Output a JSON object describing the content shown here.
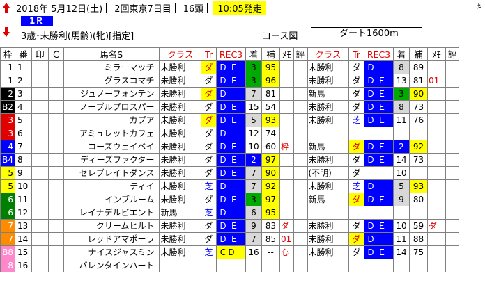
{
  "header": {
    "date": "2018年 5月12日(土)",
    "meeting": "2回東京7日目",
    "runners": "16頭",
    "start_time": "10:05発走",
    "race_no": "1Ｒ",
    "condition": "3歳･未勝利(馬齢)(牝)[指定]",
    "course_label": "コース図",
    "course": "ダート1600m",
    "corner": "ｷ"
  },
  "columns": {
    "waku": "枠",
    "ban": "番",
    "mark": "印",
    "c": "Ｃ",
    "name": "馬名S",
    "cls": "クラス",
    "tr": "Tr",
    "rec": "REC3",
    "chaku": "着",
    "ho": "補",
    "memo": "ﾒﾓ",
    "hyo": "評"
  },
  "rows": [
    {
      "waku": "1",
      "wc": "w1",
      "ban": "1",
      "name": "ミラーマッチ",
      "c1": "未勝利",
      "t1": "ダ",
      "t1c": "red",
      "t1bg": "bg-y",
      "r1": "Ｄ Ｅ",
      "r1bg": "bg-b",
      "k1": "3",
      "k1bg": "bg-g",
      "h1": "95",
      "h1bg": "bg-y",
      "m1": "",
      "m1c": "",
      "c2": "未勝利",
      "t2": "ダ",
      "t2c": "",
      "t2bg": "",
      "r2": "Ｄ",
      "r2bg": "bg-b",
      "k2": "8",
      "k2bg": "bg-lg",
      "h2": "89",
      "h2bg": "",
      "m2": "",
      "m2c": ""
    },
    {
      "waku": "1",
      "wc": "w1",
      "ban": "2",
      "name": "グラスコマチ",
      "c1": "未勝利",
      "t1": "ダ",
      "t1c": "",
      "t1bg": "",
      "r1": "Ｄ Ｅ",
      "r1bg": "bg-b",
      "k1": "3",
      "k1bg": "bg-g",
      "h1": "96",
      "h1bg": "bg-y",
      "m1": "",
      "m1c": "",
      "c2": "未勝利",
      "t2": "ダ",
      "t2c": "",
      "t2bg": "",
      "r2": "Ｄ Ｅ",
      "r2bg": "bg-b",
      "k2": "13",
      "k2bg": "",
      "h2": "81",
      "h2bg": "",
      "m2": "01",
      "m2c": "red"
    },
    {
      "waku": "2",
      "wc": "w2",
      "ban": "3",
      "name": "ジュノーフォンテン",
      "c1": "未勝利",
      "t1": "ダ",
      "t1c": "red",
      "t1bg": "bg-y",
      "r1": "Ｄ",
      "r1bg": "bg-b",
      "k1": "7",
      "k1bg": "bg-lg",
      "h1": "81",
      "h1bg": "",
      "m1": "",
      "m1c": "",
      "c2": "新馬",
      "t2": "ダ",
      "t2c": "",
      "t2bg": "",
      "r2": "Ｄ Ｅ",
      "r2bg": "bg-b",
      "k2": "3",
      "k2bg": "bg-g",
      "h2": "90",
      "h2bg": "bg-y",
      "m2": "",
      "m2c": ""
    },
    {
      "waku": "B2",
      "wc": "w2",
      "ban": "4",
      "name": "ノーブルプロスパー",
      "c1": "未勝利",
      "t1": "ダ",
      "t1c": "",
      "t1bg": "",
      "r1": "Ｄ Ｅ",
      "r1bg": "bg-b",
      "k1": "15",
      "k1bg": "",
      "h1": "54",
      "h1bg": "",
      "m1": "",
      "m1c": "",
      "c2": "未勝利",
      "t2": "ダ",
      "t2c": "",
      "t2bg": "",
      "r2": "Ｄ Ｅ",
      "r2bg": "bg-b",
      "k2": "8",
      "k2bg": "bg-lg",
      "h2": "73",
      "h2bg": "",
      "m2": "",
      "m2c": ""
    },
    {
      "waku": "3",
      "wc": "w3",
      "ban": "5",
      "name": "カプア",
      "c1": "未勝利",
      "t1": "ダ",
      "t1c": "red",
      "t1bg": "bg-y",
      "r1": "Ｄ Ｅ",
      "r1bg": "bg-b",
      "k1": "5",
      "k1bg": "bg-lg",
      "h1": "93",
      "h1bg": "bg-y",
      "m1": "",
      "m1c": "",
      "c2": "未勝利",
      "t2": "芝",
      "t2c": "blue",
      "t2bg": "",
      "r2": "Ｄ Ｅ",
      "r2bg": "bg-b",
      "k2": "11",
      "k2bg": "",
      "h2": "76",
      "h2bg": "",
      "m2": "",
      "m2c": ""
    },
    {
      "waku": "3",
      "wc": "w3",
      "ban": "6",
      "name": "アミュレットカフェ",
      "c1": "未勝利",
      "t1": "ダ",
      "t1c": "",
      "t1bg": "",
      "r1": "Ｄ",
      "r1bg": "bg-b",
      "k1": "12",
      "k1bg": "",
      "h1": "74",
      "h1bg": "",
      "m1": "",
      "m1c": "",
      "c2": "",
      "t2": "",
      "t2c": "",
      "t2bg": "",
      "r2": "",
      "r2bg": "",
      "k2": "",
      "k2bg": "",
      "h2": "",
      "h2bg": "",
      "m2": "",
      "m2c": ""
    },
    {
      "waku": "4",
      "wc": "w4",
      "ban": "7",
      "name": "コーズウェイベイ",
      "c1": "未勝利",
      "t1": "ダ",
      "t1c": "",
      "t1bg": "",
      "r1": "Ｄ Ｅ",
      "r1bg": "bg-b",
      "k1": "10",
      "k1bg": "",
      "h1": "60",
      "h1bg": "",
      "m1": "枠",
      "m1c": "red",
      "c2": "新馬",
      "t2": "ダ",
      "t2c": "red",
      "t2bg": "bg-y",
      "r2": "Ｄ Ｅ",
      "r2bg": "bg-b",
      "k2": "2",
      "k2bg": "bg-b",
      "h2": "92",
      "h2bg": "bg-y",
      "m2": "",
      "m2c": ""
    },
    {
      "waku": "B4",
      "wc": "w4",
      "ban": "8",
      "name": "ディーズファクター",
      "c1": "未勝利",
      "t1": "ダ",
      "t1c": "",
      "t1bg": "",
      "r1": "Ｄ Ｅ",
      "r1bg": "bg-b",
      "k1": "2",
      "k1bg": "bg-b",
      "h1": "97",
      "h1bg": "bg-y",
      "m1": "",
      "m1c": "",
      "c2": "未勝利",
      "t2": "ダ",
      "t2c": "",
      "t2bg": "",
      "r2": "Ｄ Ｅ",
      "r2bg": "bg-b",
      "k2": "14",
      "k2bg": "",
      "h2": "73",
      "h2bg": "",
      "m2": "",
      "m2c": ""
    },
    {
      "waku": "5",
      "wc": "w5",
      "ban": "9",
      "name": "セレブレイトダンス",
      "c1": "未勝利",
      "t1": "ダ",
      "t1c": "",
      "t1bg": "",
      "r1": "Ｄ Ｅ",
      "r1bg": "bg-b",
      "k1": "7",
      "k1bg": "bg-lg",
      "h1": "90",
      "h1bg": "bg-y",
      "m1": "",
      "m1c": "",
      "c2": "(不明)",
      "t2": "ダ",
      "t2c": "",
      "t2bg": "",
      "r2": "",
      "r2bg": "",
      "k2": "10",
      "k2bg": "",
      "h2": "",
      "h2bg": "",
      "m2": "",
      "m2c": ""
    },
    {
      "waku": "5",
      "wc": "w5",
      "ban": "10",
      "name": "ティイ",
      "c1": "未勝利",
      "t1": "芝",
      "t1c": "blue",
      "t1bg": "",
      "r1": "Ｄ",
      "r1bg": "bg-b",
      "k1": "7",
      "k1bg": "bg-lg",
      "h1": "92",
      "h1bg": "bg-y",
      "m1": "",
      "m1c": "",
      "c2": "未勝利",
      "t2": "芝",
      "t2c": "blue",
      "t2bg": "",
      "r2": "Ｄ",
      "r2bg": "bg-b",
      "k2": "5",
      "k2bg": "bg-lg",
      "h2": "93",
      "h2bg": "bg-y",
      "m2": "",
      "m2c": ""
    },
    {
      "waku": "6",
      "wc": "w6",
      "ban": "11",
      "name": "インブルーム",
      "c1": "未勝利",
      "t1": "ダ",
      "t1c": "",
      "t1bg": "",
      "r1": "Ｄ Ｅ",
      "r1bg": "bg-b",
      "k1": "3",
      "k1bg": "bg-g",
      "h1": "97",
      "h1bg": "bg-y",
      "m1": "",
      "m1c": "",
      "c2": "新馬",
      "t2": "ダ",
      "t2c": "red",
      "t2bg": "bg-y",
      "r2": "Ｄ Ｅ",
      "r2bg": "bg-b",
      "k2": "9",
      "k2bg": "bg-lg",
      "h2": "80",
      "h2bg": "",
      "m2": "",
      "m2c": ""
    },
    {
      "waku": "6",
      "wc": "w6",
      "ban": "12",
      "name": "レイナデルビエント",
      "c1": "新馬",
      "t1": "芝",
      "t1c": "blue",
      "t1bg": "",
      "r1": "Ｄ",
      "r1bg": "bg-b",
      "k1": "6",
      "k1bg": "bg-lg",
      "h1": "95",
      "h1bg": "bg-y",
      "m1": "",
      "m1c": "",
      "c2": "",
      "t2": "",
      "t2c": "",
      "t2bg": "",
      "r2": "",
      "r2bg": "",
      "k2": "",
      "k2bg": "",
      "h2": "",
      "h2bg": "",
      "m2": "",
      "m2c": ""
    },
    {
      "waku": "7",
      "wc": "w7",
      "ban": "13",
      "name": "クリームヒルト",
      "c1": "未勝利",
      "t1": "ダ",
      "t1c": "",
      "t1bg": "",
      "r1": "Ｄ Ｅ",
      "r1bg": "bg-b",
      "k1": "9",
      "k1bg": "bg-lg",
      "h1": "83",
      "h1bg": "",
      "m1": "ダ",
      "m1c": "red",
      "c2": "未勝利",
      "t2": "ダ",
      "t2c": "",
      "t2bg": "",
      "r2": "Ｄ Ｅ",
      "r2bg": "bg-b",
      "k2": "10",
      "k2bg": "",
      "h2": "59",
      "h2bg": "",
      "m2": "ダ",
      "m2c": "red"
    },
    {
      "waku": "7",
      "wc": "w7",
      "ban": "14",
      "name": "レッドアマポーラ",
      "c1": "未勝利",
      "t1": "ダ",
      "t1c": "",
      "t1bg": "",
      "r1": "Ｄ Ｅ",
      "r1bg": "bg-b",
      "k1": "7",
      "k1bg": "bg-lg",
      "h1": "85",
      "h1bg": "",
      "m1": "01",
      "m1c": "red",
      "c2": "未勝利",
      "t2": "ダ",
      "t2c": "red",
      "t2bg": "bg-y",
      "r2": "Ｄ",
      "r2bg": "bg-b",
      "k2": "11",
      "k2bg": "",
      "h2": "88",
      "h2bg": "",
      "m2": "",
      "m2c": ""
    },
    {
      "waku": "B8",
      "wc": "w8",
      "ban": "15",
      "name": "ナイスジャスミン",
      "c1": "未勝利",
      "t1": "芝",
      "t1c": "blue",
      "t1bg": "",
      "r1": "ＣＤ",
      "r1bg": "bg-y",
      "k1": "16",
      "k1bg": "",
      "h1": "--",
      "h1bg": "",
      "m1": "心",
      "m1c": "red",
      "c2": "未勝利",
      "t2": "ダ",
      "t2c": "",
      "t2bg": "",
      "r2": "Ｄ Ｅ",
      "r2bg": "bg-b",
      "k2": "14",
      "k2bg": "",
      "h2": "75",
      "h2bg": "",
      "m2": "",
      "m2c": ""
    },
    {
      "waku": "8",
      "wc": "w8",
      "ban": "16",
      "name": "バレンタインハート",
      "c1": "",
      "t1": "",
      "t1c": "",
      "t1bg": "",
      "r1": "",
      "r1bg": "",
      "k1": "",
      "k1bg": "",
      "h1": "",
      "h1bg": "",
      "m1": "",
      "m1c": "",
      "c2": "",
      "t2": "",
      "t2c": "",
      "t2bg": "",
      "r2": "",
      "r2bg": "",
      "k2": "",
      "k2bg": "",
      "h2": "",
      "h2bg": "",
      "m2": "",
      "m2c": ""
    }
  ],
  "colors": {
    "start_bg": "#ffff00",
    "race_no_bg": "#0000ff",
    "red_text": "#e00000",
    "blue_text": "#0000ff",
    "rec_bg": "#0000ff",
    "green": "#00aa00"
  }
}
